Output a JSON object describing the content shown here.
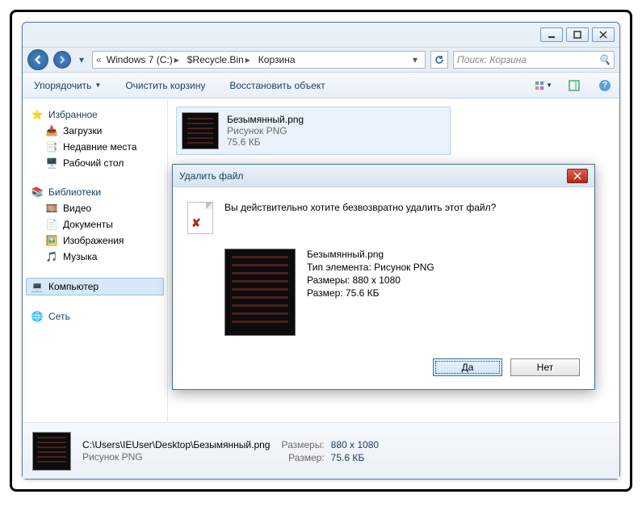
{
  "breadcrumb": {
    "seg0": "Windows 7 (C:)",
    "seg1": "$Recycle.Bin",
    "seg2": "Корзина"
  },
  "search": {
    "placeholder": "Поиск: Корзина"
  },
  "toolbar": {
    "organize": "Упорядочить",
    "empty": "Очистить корзину",
    "restore": "Восстановить объект"
  },
  "sidebar": {
    "favorites": "Избранное",
    "downloads": "Загрузки",
    "recent": "Недавние места",
    "desktop": "Рабочий стол",
    "libraries": "Библиотеки",
    "videos": "Видео",
    "documents": "Документы",
    "pictures": "Изображения",
    "music": "Музыка",
    "computer": "Компьютер",
    "network": "Сеть"
  },
  "file": {
    "name": "Безымянный.png",
    "type": "Рисунок PNG",
    "size": "75.6 КБ"
  },
  "dialog": {
    "title": "Удалить файл",
    "message": "Вы действительно хотите безвозвратно удалить этот файл?",
    "fname": "Безымянный.png",
    "ftype": "Тип элемента: Рисунок PNG",
    "fdim": "Размеры: 880 x 1080",
    "fsize": "Размер: 75.6 КБ",
    "yes": "Да",
    "no": "Нет"
  },
  "details": {
    "path": "C:\\Users\\IEUser\\Desktop\\Безымянный.png",
    "type": "Рисунок PNG",
    "dim_label": "Размеры:",
    "dim_value": "880 x 1080",
    "size_label": "Размер:",
    "size_value": "75.6 КБ"
  }
}
